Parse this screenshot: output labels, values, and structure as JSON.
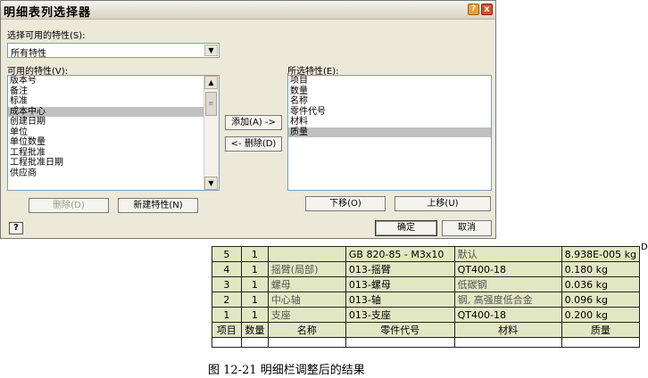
{
  "dialog": {
    "title": "明细表列选择器",
    "select_label": "选择可用的特性(S):",
    "combo_value": "所有特性",
    "available_label": "可用的特性(V):",
    "selected_label": "所选特性(E):",
    "available_items": [
      "版本号",
      "备注",
      "标准",
      "成本中心",
      "创建日期",
      "单位",
      "单位数量",
      "工程批准",
      "工程批准日期",
      "供应商"
    ],
    "available_selected_index": 3,
    "selected_items": [
      "项目",
      "数量",
      "名称",
      "零件代号",
      "材料",
      "质量"
    ],
    "selected_selected_index": 5,
    "add_button": "添加(A) ->",
    "remove_button": "<- 删除(D)",
    "delete_button": "删除(D)",
    "new_property_button": "新建特性(N)",
    "move_down_button": "下移(O)",
    "move_up_button": "上移(U)",
    "ok_button": "确定",
    "cancel_button": "取消",
    "help_button": "?",
    "titlebar_help": "?",
    "titlebar_close": "x"
  },
  "parts_list": {
    "rows": [
      [
        "5",
        "1",
        "",
        "GB 820-85 - M3x10",
        "默认",
        "8.938E-005 kg"
      ],
      [
        "4",
        "1",
        "摇臂(局部)",
        "013-摇臂",
        "QT400-18",
        "0.180 kg"
      ],
      [
        "3",
        "1",
        "螺母",
        "013-螺母",
        "低碳钢",
        "0.036 kg"
      ],
      [
        "2",
        "1",
        "中心轴",
        "013-轴",
        "钢, 高强度低合金",
        "0.096 kg"
      ],
      [
        "1",
        "1",
        "支座",
        "013-支座",
        "QT400-18",
        "0.200 kg"
      ]
    ],
    "headers": [
      "项目",
      "数量",
      "名称",
      "零件代号",
      "材料",
      "质量"
    ],
    "edge_mark": "D"
  },
  "caption": "图 12-21  明细栏调整后的结果"
}
